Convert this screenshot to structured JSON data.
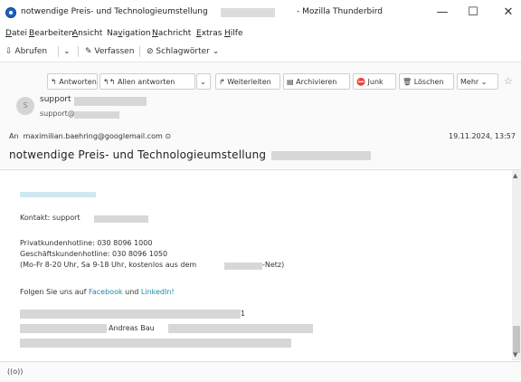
{
  "window": {
    "title": "notwendige Preis- und Technologieumstellung",
    "title_suffix": "- Mozilla Thunderbird",
    "minimize_glyph": "—",
    "maximize_glyph": "☐",
    "close_glyph": "✕"
  },
  "menu": [
    {
      "accel": "D",
      "rest": "atei"
    },
    {
      "accel": "B",
      "rest": "earbeiten"
    },
    {
      "accel": "A",
      "rest": "nsicht"
    },
    {
      "pre": "Na",
      "accel": "v",
      "rest": "igation"
    },
    {
      "accel": "N",
      "rest": "achricht"
    },
    {
      "accel": "E",
      "rest": "xtras"
    },
    {
      "accel": "H",
      "rest": "ilfe"
    }
  ],
  "toolbar": {
    "get_messages": "Abrufen",
    "compose": "Verfassen",
    "tags": "Schlagwörter"
  },
  "actions": {
    "reply": "Antworten",
    "reply_all": "Allen antworten",
    "forward": "Weiterleiten",
    "archive": "Archivieren",
    "junk": "Junk",
    "delete": "Löschen",
    "more": "Mehr"
  },
  "message": {
    "avatar_letter": "S",
    "sender_name": "support",
    "sender_address": "support@",
    "to_label": "An",
    "to_address": "maximilian.baehring@googlemail.com",
    "date": "19.11.2024, 13:57",
    "subject": "notwendige Preis- und Technologieumstellung"
  },
  "body": {
    "contact": "Kontakt: support",
    "hotline_private": "Privatkundenhotline: 030 8096 1000",
    "hotline_business": "Geschäftskundenhotline: 030 8096 1050",
    "hours_start": "(Mo-Fr 8-20 Uhr, Sa 9-18 Uhr, kostenlos aus dem",
    "hours_end": "-Netz)",
    "follow_prefix": "Folgen Sie uns auf",
    "facebook": "Facebook",
    "and": "und",
    "linkedin": "LinkedIn!",
    "signature_name": "Andreas Bau",
    "sig_bracket": "1"
  },
  "status": {
    "activity_icon": "((o))"
  }
}
